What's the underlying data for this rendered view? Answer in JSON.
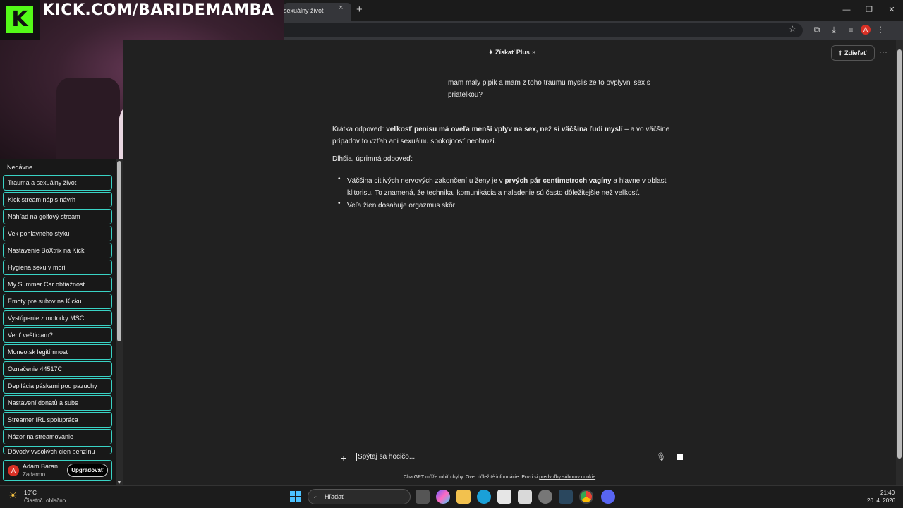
{
  "browser": {
    "tab_title": "sexuálny život",
    "tab_close": "×",
    "new_tab": "+",
    "window_controls": [
      "—",
      "❐",
      "✕"
    ],
    "toolbar_icons": [
      "bookmark-star-icon",
      "extensions-icon",
      "download-icon",
      "media-icon"
    ],
    "profile_letter": "A",
    "menu": "⋮"
  },
  "webcam": {
    "logo_letter": "K",
    "stream_url": "KICK.COM/BARIDEMAMBA",
    "logo_color": "#53fc18"
  },
  "sidebar": {
    "heading": "Nedávne",
    "items": [
      "Trauma a sexuálny život",
      "Kick stream nápis návrh",
      "Náhľad na golfový stream",
      "Vek pohlavného styku",
      "Nastavenie BoXtrix na Kick",
      "Hygiena sexu v mori",
      "My Summer Car obtiažnosť",
      "Emoty pre subov na Kicku",
      "Vystúpenie z motorky MSC",
      "Veriť vešticiam?",
      "Moneo.sk legitímnosť",
      "Označenie 44517C",
      "Depilácia páskami pod pazuchy",
      "Nastavení donatů a subs",
      "Streamer IRL spolupráca",
      "Názor na streamovanie",
      "Dôvody vysokých cien benzínu"
    ],
    "accent": "#39d3c5",
    "user": {
      "avatar_letter": "A",
      "name": "Adam Baran",
      "plan": "Zadarmo",
      "upgrade_label": "Upgradovať"
    }
  },
  "header": {
    "plus_label": "✦ Získať Plus",
    "plus_close": "×",
    "share_label": "⇧ Zdieľať",
    "more": "···"
  },
  "chat": {
    "user_message": "mam maly pipik a mam z toho traumu myslis ze to ovplyvni sex s priatelkou?",
    "reply_intro_plain": "Krátka odpoveď: ",
    "reply_intro_bold": "veľkosť penisu má oveľa menší vplyv na sex, než si väčšina ľudí myslí",
    "reply_intro_rest": " – a vo väčšine prípadov to vzťah ani sexuálnu spokojnosť neohrozí.",
    "reply_long_heading": "Dlhšia, úprimná odpoveď:",
    "bullet1_a": "Väčšina citlivých nervových zakončení u ženy je v ",
    "bullet1_bold": "prvých pár centimetroch vagíny",
    "bullet1_b": " a hlavne v oblasti klitorisu. To znamená, že technika, komunikácia a naladenie sú často dôležitejšie než veľkosť.",
    "bullet2": "Veľa žien dosahuje orgazmus skôr"
  },
  "composer": {
    "plus": "+",
    "placeholder": "Spýtaj sa hocičo...",
    "mic": "🎙",
    "disclaimer_text": "ChatGPT môže robiť chyby. Over dôležité informácie. Pozri si ",
    "disclaimer_link": "predvoľby súborov cookie",
    "disclaimer_end": "."
  },
  "taskbar": {
    "weather_icon": "☀",
    "temp": "10°C",
    "weather": "Čiastoč. oblačno",
    "search_icon": "⌕",
    "search_label": "Hľadať",
    "time": "21:40",
    "date": "20. 4. 2026",
    "apps": [
      "task-view-icon",
      "copilot-icon",
      "file-explorer-icon",
      "edge-icon",
      "store-icon",
      "office-icon",
      "github-icon",
      "steam-icon",
      "chrome-icon",
      "discord-icon"
    ]
  }
}
